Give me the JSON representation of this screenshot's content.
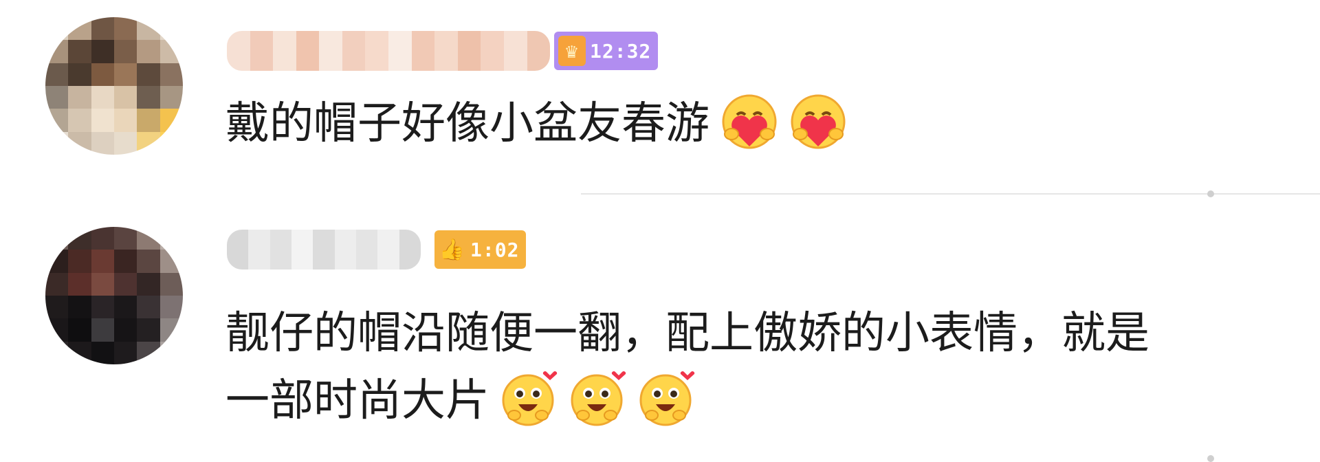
{
  "comments": [
    {
      "badge": {
        "text": "12:32",
        "icon": "crown-icon"
      },
      "text": "戴的帽子好像小盆友春游",
      "emojis": [
        "hugging-heart-icon",
        "hugging-heart-icon"
      ]
    },
    {
      "badge": {
        "text": "1:02",
        "icon": "thumbs-up-icon"
      },
      "text_lines": [
        "靓仔的帽沿随便一翻，配上傲娇的小表情，就是",
        "一部时尚大片"
      ],
      "emojis": [
        "heart-eyes-excited-icon",
        "heart-eyes-excited-icon",
        "heart-eyes-excited-icon"
      ]
    }
  ],
  "colors": {
    "badge1_bg": "#b18df0",
    "badge1_icon": "#f6a23a",
    "badge2_bg": "#f6b23e",
    "divider": "#e6e6e6"
  }
}
